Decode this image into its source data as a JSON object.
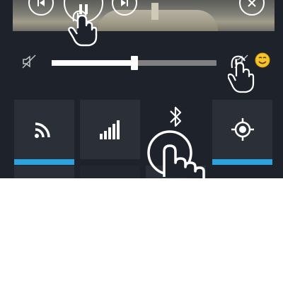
{
  "media_controls": [
    {
      "name": "previous-icon"
    },
    {
      "name": "pause-icon"
    },
    {
      "name": "next-icon"
    },
    {
      "name": "close-icon"
    }
  ],
  "volume": {
    "muted_icon": "speaker-muted-icon",
    "level_fraction": 0.5,
    "right_icon": "volume-icon"
  },
  "quick_tiles": [
    {
      "name": "wifi-icon",
      "active": true
    },
    {
      "name": "signal-icon",
      "active": false
    },
    {
      "name": "bluetooth-icon",
      "active": false
    },
    {
      "name": "location-icon",
      "active": true
    }
  ],
  "colors": {
    "background": "#1e222b",
    "tile": "#2b3038",
    "accent": "#2aa3e0"
  }
}
